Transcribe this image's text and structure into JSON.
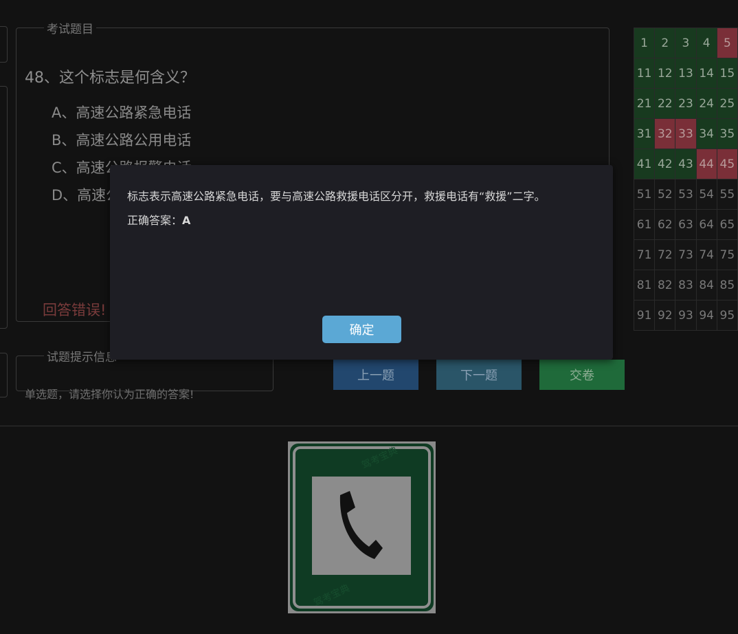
{
  "exam": {
    "legend": "考试题目",
    "question": "48、这个标志是何含义？",
    "options": [
      {
        "label": "A、高速公路紧急电话"
      },
      {
        "label": "B、高速公路公用电话"
      },
      {
        "label": "C、高速公路报警电话"
      },
      {
        "label": "D、高速公路救援电话"
      }
    ],
    "result": "回答错误!"
  },
  "tip": {
    "legend": "试题提示信息",
    "text": "单选题，请选择你认为正确的答案!"
  },
  "buttons": {
    "prev": "上一题",
    "next": "下一题",
    "submit": "交卷",
    "prev_color": "#22476e",
    "next_color": "#2a5568",
    "submit_color": "#1f6a3a"
  },
  "grid": {
    "rows": [
      [
        {
          "n": "1",
          "s": "ok"
        },
        {
          "n": "2",
          "s": "ok"
        },
        {
          "n": "3",
          "s": "ok"
        },
        {
          "n": "4",
          "s": "ok"
        },
        {
          "n": "5",
          "s": "bad"
        }
      ],
      [
        {
          "n": "11",
          "s": "ok"
        },
        {
          "n": "12",
          "s": "ok"
        },
        {
          "n": "13",
          "s": "ok"
        },
        {
          "n": "14",
          "s": "ok"
        },
        {
          "n": "15",
          "s": "ok"
        }
      ],
      [
        {
          "n": "21",
          "s": "ok"
        },
        {
          "n": "22",
          "s": "ok"
        },
        {
          "n": "23",
          "s": "ok"
        },
        {
          "n": "24",
          "s": "ok"
        },
        {
          "n": "25",
          "s": "ok"
        }
      ],
      [
        {
          "n": "31",
          "s": "ok"
        },
        {
          "n": "32",
          "s": "bad"
        },
        {
          "n": "33",
          "s": "bad"
        },
        {
          "n": "34",
          "s": "ok"
        },
        {
          "n": "35",
          "s": "ok"
        }
      ],
      [
        {
          "n": "41",
          "s": "ok"
        },
        {
          "n": "42",
          "s": "ok"
        },
        {
          "n": "43",
          "s": "ok"
        },
        {
          "n": "44",
          "s": "bad"
        },
        {
          "n": "45",
          "s": "bad"
        }
      ],
      [
        {
          "n": "51",
          "s": ""
        },
        {
          "n": "52",
          "s": ""
        },
        {
          "n": "53",
          "s": ""
        },
        {
          "n": "54",
          "s": ""
        },
        {
          "n": "55",
          "s": ""
        }
      ],
      [
        {
          "n": "61",
          "s": ""
        },
        {
          "n": "62",
          "s": ""
        },
        {
          "n": "63",
          "s": ""
        },
        {
          "n": "64",
          "s": ""
        },
        {
          "n": "65",
          "s": ""
        }
      ],
      [
        {
          "n": "71",
          "s": ""
        },
        {
          "n": "72",
          "s": ""
        },
        {
          "n": "73",
          "s": ""
        },
        {
          "n": "74",
          "s": ""
        },
        {
          "n": "75",
          "s": ""
        }
      ],
      [
        {
          "n": "81",
          "s": ""
        },
        {
          "n": "82",
          "s": ""
        },
        {
          "n": "83",
          "s": ""
        },
        {
          "n": "84",
          "s": ""
        },
        {
          "n": "85",
          "s": ""
        }
      ],
      [
        {
          "n": "91",
          "s": ""
        },
        {
          "n": "92",
          "s": ""
        },
        {
          "n": "93",
          "s": ""
        },
        {
          "n": "94",
          "s": ""
        },
        {
          "n": "95",
          "s": ""
        }
      ]
    ]
  },
  "sign": {
    "icon": "telephone-handset-icon",
    "watermark": "驾考宝典"
  },
  "modal": {
    "explanation": "标志表示高速公路紧急电话，要与高速公路救援电话区分开，救援电话有“救援”二字。",
    "answer_label": "正确答案：",
    "answer_value": "A",
    "confirm": "确定"
  }
}
